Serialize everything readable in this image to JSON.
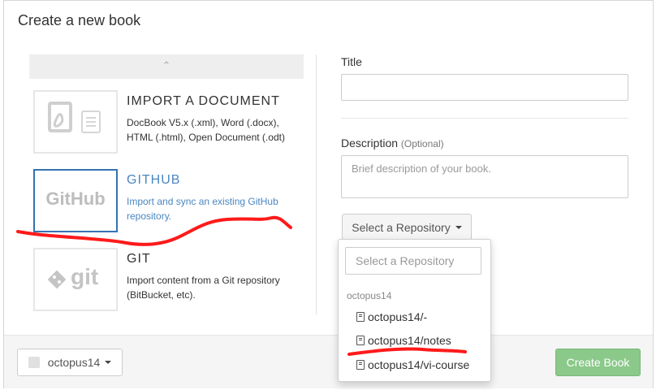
{
  "modal": {
    "title": "Create a new book"
  },
  "left": {
    "scroll_up_glyph": "⌃",
    "options": [
      {
        "title": "IMPORT A DOCUMENT",
        "description": "DocBook V5.x (.xml), Word (.docx), HTML (.html), Open Document (.odt)",
        "icon": "pdf-document-icon"
      },
      {
        "title": "GITHUB",
        "description": "Import and sync an existing GitHub repository.",
        "logo_text": "GitHub",
        "icon": "github-logo"
      },
      {
        "title": "GIT",
        "description": "Import content from a Git repository (BitBucket, etc).",
        "logo_text": "git",
        "icon": "git-logo"
      }
    ]
  },
  "form": {
    "title_label": "Title",
    "title_value": "",
    "description_label": "Description",
    "description_optional": "(Optional)",
    "description_placeholder": "Brief description of your book.",
    "repo_button_label": "Select a Repository"
  },
  "dropdown": {
    "search_placeholder": "Select a Repository",
    "group": "octopus14",
    "items": [
      "octopus14/-",
      "octopus14/notes",
      "octopus14/vi-course"
    ]
  },
  "footer": {
    "user_label": "octopus14",
    "create_label": "Create Book"
  },
  "colors": {
    "accent": "#4a86c1",
    "selected_border": "#3572b0",
    "create_button": "#8bc98a",
    "annotation": "#ff1a1a"
  }
}
